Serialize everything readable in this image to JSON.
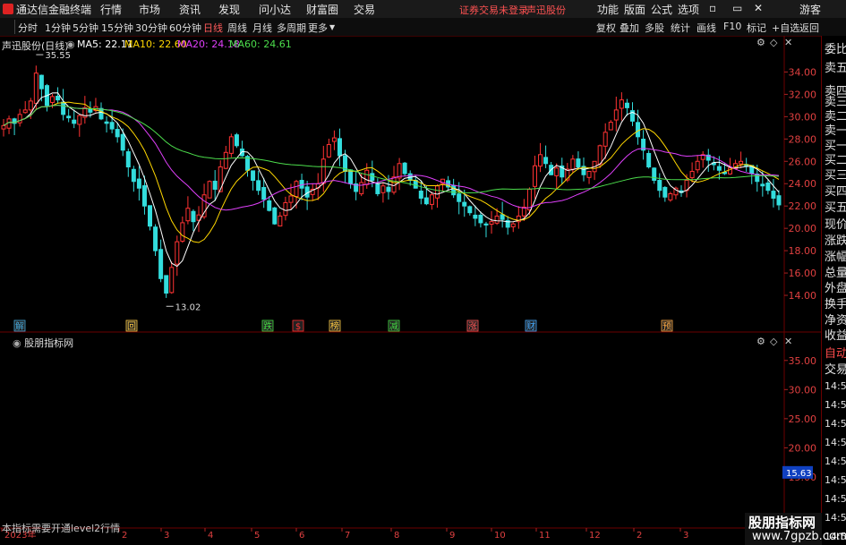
{
  "menu": {
    "app_title": "通达信金融终端",
    "items": [
      "行情",
      "市场",
      "资讯",
      "发现",
      "问小达",
      "财富圈",
      "交易"
    ],
    "login_notice": "证券交易未登录",
    "stock_name": "声迅股份",
    "right_items": [
      "功能",
      "版面",
      "公式",
      "选项"
    ],
    "guest": "游客"
  },
  "toolbar": {
    "periods": [
      "分时",
      "1分钟",
      "5分钟",
      "15分钟",
      "30分钟",
      "60分钟",
      "日线",
      "周线",
      "月线",
      "多周期",
      "更多"
    ],
    "active_period": "日线",
    "right_buttons": [
      "复权",
      "叠加",
      "多股",
      "统计",
      "画线",
      "F10",
      "标记",
      "+自选",
      "返回"
    ]
  },
  "legend": {
    "title": "声迅股份(日线)",
    "ma": [
      {
        "label": "MA5: 22.11",
        "color": "#ffffff"
      },
      {
        "label": "MA10: 22.60",
        "color": "#ffd700"
      },
      {
        "label": "MA20: 24.18",
        "color": "#e040fb"
      },
      {
        "label": "MA60: 24.61",
        "color": "#4cdd4c"
      }
    ]
  },
  "indicator": {
    "title": "股朋指标网",
    "note": "本指标需要开通level2行情",
    "current_value": "15.63"
  },
  "right_panel": {
    "labels": [
      "委比",
      "卖五",
      "卖四",
      "卖三",
      "卖二",
      "卖一",
      "买一",
      "买二",
      "买三",
      "买四",
      "买五",
      "现价",
      "涨跌",
      "涨幅",
      "总量",
      "外盘",
      "换手",
      "净资",
      "收益",
      "自动",
      "交易"
    ],
    "times": [
      "14:55",
      "14:55",
      "14:55",
      "14:55",
      "14:56",
      "14:56",
      "14:56",
      "14:56",
      "14:56"
    ]
  },
  "watermark": {
    "line1": "股朋指标网",
    "line2": "www.7gpzb.com"
  },
  "colors": {
    "up": "#ff3333",
    "down": "#33dddd",
    "panel_border": "#6b0000"
  },
  "chart_data": [
    {
      "type": "candlestick",
      "title": "声迅股份(日线)",
      "y_ticks": [
        14.0,
        16.0,
        18.0,
        20.0,
        22.0,
        24.0,
        26.0,
        28.0,
        30.0,
        32.0,
        34.0
      ],
      "ylim": [
        12.4,
        36.6
      ],
      "annotations": {
        "high": "35.55",
        "low": "13.02"
      },
      "x_labels": [
        "2023年",
        "2",
        "3",
        "4",
        "5",
        "6",
        "7",
        "8",
        "9",
        "10",
        "11",
        "12",
        "2",
        "3"
      ],
      "event_markers": [
        "解",
        "回",
        "跌",
        "$",
        "榜",
        "减",
        "涨",
        "财",
        "预"
      ],
      "closes": [
        29.2,
        29.8,
        29.4,
        30.2,
        30.6,
        31.4,
        33.9,
        32.5,
        31.0,
        31.8,
        31.5,
        30.2,
        29.9,
        29.4,
        30.1,
        30.8,
        30.4,
        30.9,
        29.8,
        29.4,
        28.9,
        28.2,
        27.0,
        25.5,
        24.2,
        23.6,
        22.0,
        20.2,
        18.0,
        15.5,
        14.2,
        16.5,
        18.8,
        20.5,
        21.8,
        20.6,
        21.2,
        23.0,
        24.2,
        23.5,
        25.5,
        26.8,
        28.2,
        27.4,
        26.5,
        25.2,
        24.3,
        23.4,
        22.6,
        21.6,
        20.4,
        21.1,
        22.3,
        22.9,
        24.2,
        23.6,
        22.8,
        23.5,
        24.0,
        26.2,
        27.5,
        28.1,
        26.5,
        25.1,
        24.0,
        23.3,
        24.1,
        25.2,
        24.3,
        23.1,
        23.8,
        23.3,
        24.6,
        25.8,
        24.9,
        24.3,
        23.6,
        22.7,
        22.2,
        23.0,
        23.8,
        24.4,
        23.7,
        23.0,
        22.4,
        22.0,
        21.4,
        20.9,
        20.5,
        20.3,
        20.6,
        21.1,
        20.8,
        20.1,
        20.4,
        21.1,
        21.9,
        23.5,
        25.6,
        26.6,
        25.8,
        24.8,
        25.4,
        24.6,
        25.3,
        26.2,
        25.5,
        24.8,
        25.1,
        26.0,
        27.4,
        28.6,
        29.5,
        30.6,
        31.5,
        30.8,
        29.6,
        28.2,
        27.0,
        25.5,
        24.3,
        23.4,
        22.8,
        23.1,
        23.6,
        23.2,
        24.3,
        25.1,
        26.0,
        26.6,
        26.1,
        25.7,
        25.2,
        24.9,
        25.4,
        25.8,
        26.0,
        25.6,
        24.9,
        24.2,
        23.8,
        23.4,
        22.7,
        22.1
      ]
    },
    {
      "type": "line",
      "title": "股朋指标网",
      "y_ticks": [
        15.0,
        20.0,
        25.0,
        30.0,
        35.0
      ],
      "ylim": [
        9.0,
        38.5
      ],
      "values": [
        15.63
      ],
      "last_value": "15.63"
    }
  ]
}
